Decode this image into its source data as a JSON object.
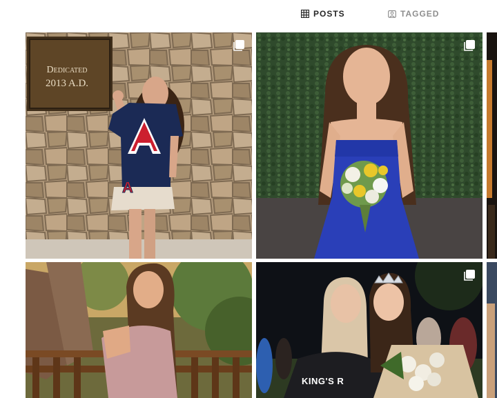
{
  "tabs": [
    {
      "label": "POSTS",
      "icon": "grid-icon",
      "active": true
    },
    {
      "label": "TAGGED",
      "icon": "tagged-icon",
      "active": false
    }
  ],
  "posts": [
    {
      "icon": "multiple-photos-icon",
      "plaque_line1": "Dedicated",
      "plaque_line2": "2013 A.D.",
      "shirt_letter": "A"
    },
    {
      "icon": "multiple-photos-icon"
    },
    {},
    {},
    {
      "icon": "multiple-photos-icon",
      "shirt_text": "KING'S R"
    },
    {}
  ],
  "colors": {
    "tab_active": "#262626",
    "tab_inactive": "#8e8e8e",
    "navy": "#1b2a55",
    "arizona_red": "#cc1f2f",
    "dress_blue": "#2a3fb8"
  }
}
